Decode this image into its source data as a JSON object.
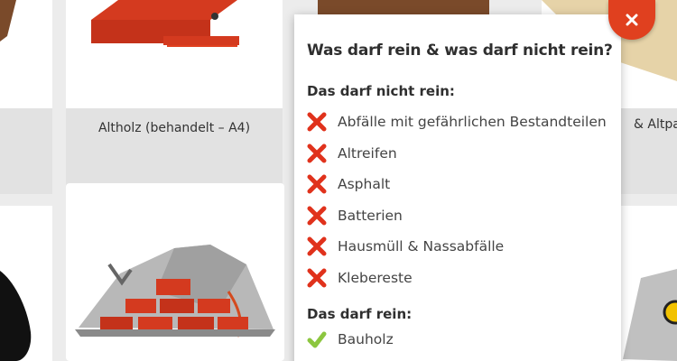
{
  "cards": {
    "altholz_label": "Altholz (behandelt – A4)",
    "right_label_partial": "& Altpa"
  },
  "popup": {
    "title": "Was darf rein & was darf nicht rein?",
    "not_allowed_title": "Das darf nicht rein:",
    "not_allowed_items": [
      "Abfälle mit gefährlichen Bestandteilen",
      "Altreifen",
      "Asphalt",
      "Batterien",
      "Hausmüll & Nassabfälle",
      "Klebereste"
    ],
    "allowed_title": "Das darf rein:",
    "allowed_items": [
      "Bauholz"
    ]
  },
  "icons": {
    "close": "close-icon",
    "not_allowed": "red-x-icon",
    "allowed": "green-check-icon"
  },
  "colors": {
    "accent": "#e0401f",
    "cross": "#e0321c",
    "check": "#8cc63f"
  }
}
